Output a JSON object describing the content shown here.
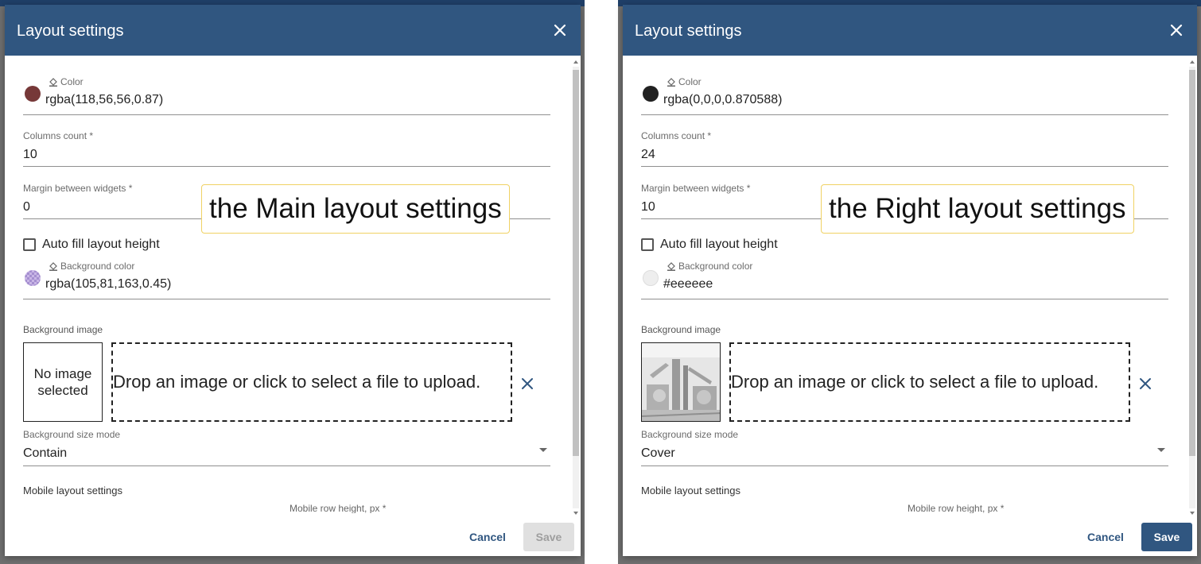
{
  "left": {
    "title": "Layout settings",
    "color": {
      "label": "Color",
      "value": "rgba(118,56,56,0.87)",
      "swatch": "#763838"
    },
    "columns": {
      "label": "Columns count *",
      "value": "10"
    },
    "margin": {
      "label": "Margin between widgets *",
      "value": "0"
    },
    "auto_fill": {
      "label": "Auto fill layout height"
    },
    "bg_color": {
      "label": "Background color",
      "value": "rgba(105,81,163,0.45)"
    },
    "bg_image": {
      "label": "Background image",
      "no_image": "No image selected",
      "dropzone": "Drop an image or click to select a file to upload."
    },
    "bg_size": {
      "label": "Background size mode",
      "value": "Contain"
    },
    "mobile": {
      "label": "Mobile layout settings",
      "row_height": "Mobile row height, px *"
    },
    "footer": {
      "cancel": "Cancel",
      "save": "Save"
    },
    "callout": "the Main layout settings"
  },
  "right": {
    "title": "Layout settings",
    "color": {
      "label": "Color",
      "value": "rgba(0,0,0,0.870588)",
      "swatch": "#212121"
    },
    "columns": {
      "label": "Columns count *",
      "value": "24"
    },
    "margin": {
      "label": "Margin between widgets *",
      "value": "10"
    },
    "auto_fill": {
      "label": "Auto fill layout height"
    },
    "bg_color": {
      "label": "Background color",
      "value": "#eeeeee"
    },
    "bg_image": {
      "label": "Background image",
      "dropzone": "Drop an image or click to select a file to upload."
    },
    "bg_size": {
      "label": "Background size mode",
      "value": "Cover"
    },
    "mobile": {
      "label": "Mobile layout settings",
      "row_height": "Mobile row height, px *"
    },
    "footer": {
      "cancel": "Cancel",
      "save": "Save"
    },
    "callout": "the Right layout settings"
  },
  "colors": {
    "header": "#305680",
    "accent": "#305680",
    "callout_border": "#f0d264"
  }
}
